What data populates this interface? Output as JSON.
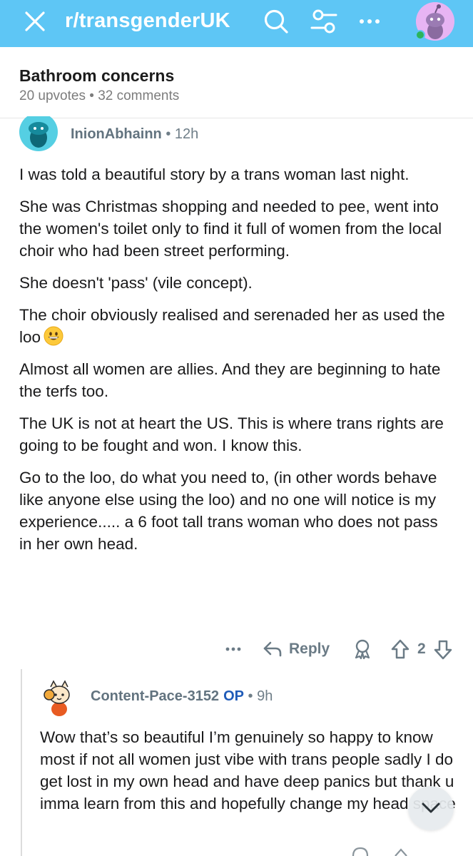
{
  "topbar": {
    "subreddit": "r/transgenderUK",
    "icons": [
      "close-icon",
      "search-icon",
      "filter-icon",
      "more-icon",
      "user-avatar"
    ],
    "bg_color": "#5ec6f5"
  },
  "post": {
    "title": "Bathroom concerns",
    "upvotes": "20 upvotes",
    "separator": "•",
    "comments": "32 comments"
  },
  "comment1": {
    "username": "InionAbhainn",
    "dot": "•",
    "time": "12h",
    "paragraphs": [
      "I was told a beautiful story by a trans woman last night.",
      "She was Christmas shopping and needed to pee, went into the women's toilet only to find it full of women from the local choir who had been street performing.",
      "She doesn't 'pass' (vile concept).",
      "The choir obviously realised and serenaded her as used the loo",
      "Almost all women are allies. And they are beginning to hate the terfs too.",
      "The UK is not at heart the US. This is where trans rights are going to be fought and won. I know this.",
      "Go to the loo, do what you need to, (in other words behave like anyone else using the loo) and no one will notice is my experience..... a 6 foot tall trans woman who does not pass in her own head."
    ],
    "emoji": "grinning-face-emoji",
    "actions": {
      "reply": "Reply",
      "score": "2"
    }
  },
  "comment2": {
    "username": "Content-Pace-3152",
    "op_badge": "OP",
    "dot": "•",
    "time": "9h",
    "body": "Wow that’s so beautiful I’m genuinely so happy to know most if not all women just vibe with trans people sadly I do get lost in my own head and have deep panics but thank u imma learn from this and hopefully change my head space"
  },
  "accent_colors": {
    "op": "#1f5bb8",
    "meta": "#7c7c7c",
    "online": "#2bb45a"
  }
}
